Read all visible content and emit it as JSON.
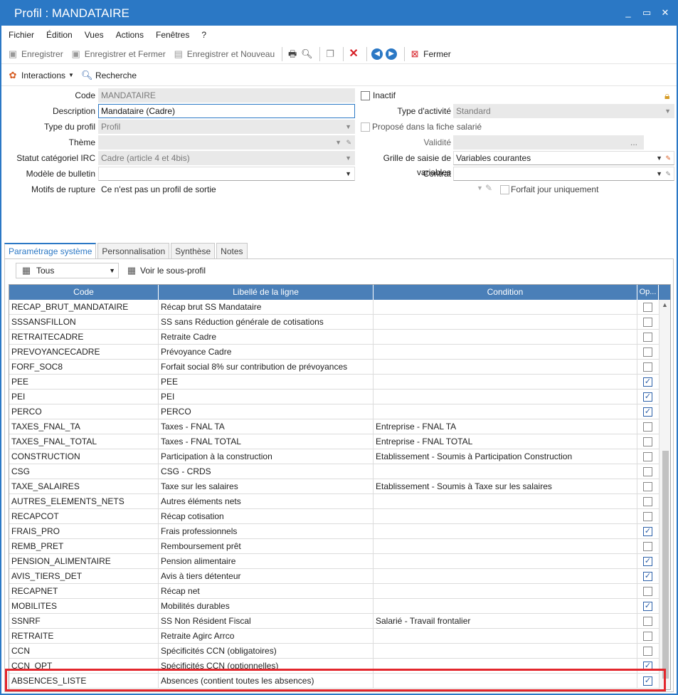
{
  "window": {
    "title": "Profil : MANDATAIRE",
    "controls": [
      "_",
      "▭",
      "✕"
    ]
  },
  "menu": [
    "Fichier",
    "Édition",
    "Vues",
    "Actions",
    "Fenêtres",
    "?"
  ],
  "toolbar": {
    "save": "Enregistrer",
    "save_close": "Enregistrer et Fermer",
    "save_new": "Enregistrer et Nouveau",
    "close": "Fermer"
  },
  "subbar": {
    "interactions": "Interactions",
    "search": "Recherche"
  },
  "form": {
    "code_label": "Code",
    "code_value": "MANDATAIRE",
    "inactif_label": "Inactif",
    "description_label": "Description",
    "description_value": "Mandataire (Cadre)",
    "type_activite_label": "Type d'activité",
    "type_activite_value": "Standard",
    "type_profil_label": "Type du profil",
    "type_profil_value": "Profil",
    "propose_label": "Proposé dans la fiche salarié",
    "theme_label": "Thème",
    "theme_value": "",
    "validite_label": "Validité",
    "validite_value": "...",
    "statut_label": "Statut catégoriel IRC",
    "statut_value": "Cadre (article 4 et 4bis)",
    "grille_label": "Grille de saisie de variables",
    "grille_value": "Variables courantes",
    "modele_label": "Modèle de bulletin",
    "modele_value": "",
    "contrat_label": "Contrat",
    "contrat_value": "",
    "motifs_label": "Motifs de rupture",
    "motifs_value": "Ce n'est pas un profil de sortie",
    "forfait_label": "Forfait jour uniquement"
  },
  "tabs": [
    "Paramétrage système",
    "Personnalisation",
    "Synthèse",
    "Notes"
  ],
  "gridbar": {
    "filter": "Tous",
    "view_sub": "Voir le sous-profil"
  },
  "grid": {
    "columns": [
      "Code",
      "Libellé de la ligne",
      "Condition",
      "Op..."
    ],
    "rows": [
      {
        "code": "RECAP_BRUT_MANDATAIRE",
        "label": "Récap brut SS Mandataire",
        "cond": "",
        "op": false
      },
      {
        "code": "SSSANSFILLON",
        "label": "SS sans Réduction générale de cotisations",
        "cond": "",
        "op": false
      },
      {
        "code": "RETRAITECADRE",
        "label": "Retraite Cadre",
        "cond": "",
        "op": false
      },
      {
        "code": "PREVOYANCECADRE",
        "label": "Prévoyance Cadre",
        "cond": "",
        "op": false
      },
      {
        "code": "FORF_SOC8",
        "label": "Forfait social 8% sur contribution de prévoyances",
        "cond": "",
        "op": false
      },
      {
        "code": "PEE",
        "label": "PEE",
        "cond": "",
        "op": true
      },
      {
        "code": "PEI",
        "label": "PEI",
        "cond": "",
        "op": true
      },
      {
        "code": "PERCO",
        "label": "PERCO",
        "cond": "",
        "op": true
      },
      {
        "code": "TAXES_FNAL_TA",
        "label": "Taxes - FNAL TA",
        "cond": "Entreprise - FNAL TA",
        "op": false
      },
      {
        "code": "TAXES_FNAL_TOTAL",
        "label": "Taxes - FNAL TOTAL",
        "cond": "Entreprise - FNAL TOTAL",
        "op": false
      },
      {
        "code": "CONSTRUCTION",
        "label": "Participation à la construction",
        "cond": "Etablissement - Soumis à Participation Construction",
        "op": false
      },
      {
        "code": "CSG",
        "label": "CSG - CRDS",
        "cond": "",
        "op": false
      },
      {
        "code": "TAXE_SALAIRES",
        "label": "Taxe sur les salaires",
        "cond": "Etablissement - Soumis à Taxe sur les salaires",
        "op": false
      },
      {
        "code": "AUTRES_ELEMENTS_NETS",
        "label": "Autres éléments nets",
        "cond": "",
        "op": false
      },
      {
        "code": "RECAPCOT",
        "label": "Récap cotisation",
        "cond": "",
        "op": false
      },
      {
        "code": "FRAIS_PRO",
        "label": "Frais professionnels",
        "cond": "",
        "op": true
      },
      {
        "code": "REMB_PRET",
        "label": "Remboursement prêt",
        "cond": "",
        "op": false
      },
      {
        "code": "PENSION_ALIMENTAIRE",
        "label": "Pension alimentaire",
        "cond": "",
        "op": true
      },
      {
        "code": "AVIS_TIERS_DET",
        "label": "Avis à tiers détenteur",
        "cond": "",
        "op": true
      },
      {
        "code": "RECAPNET",
        "label": "Récap net",
        "cond": "",
        "op": false
      },
      {
        "code": "MOBILITES",
        "label": "Mobilités durables",
        "cond": "",
        "op": true
      },
      {
        "code": "SSNRF",
        "label": "SS Non Résident Fiscal",
        "cond": "Salarié - Travail frontalier",
        "op": false
      },
      {
        "code": "RETRAITE",
        "label": "Retraite Agirc Arrco",
        "cond": "",
        "op": false
      },
      {
        "code": "CCN",
        "label": "Spécificités CCN (obligatoires)",
        "cond": "",
        "op": false
      },
      {
        "code": "CCN_OPT",
        "label": "Spécificités CCN (optionnelles)",
        "cond": "",
        "op": true
      },
      {
        "code": "ABSENCES_LISTE",
        "label": "Absences (contient toutes les absences)",
        "cond": "",
        "op": true
      }
    ]
  },
  "colors": {
    "accent": "#2b78c5",
    "grid_header": "#4a7fb8",
    "highlight": "#e3262c"
  }
}
